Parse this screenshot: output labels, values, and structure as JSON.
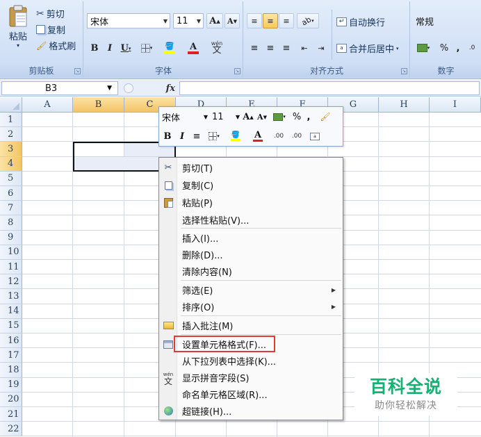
{
  "ribbon": {
    "clipboard": {
      "paste_label": "粘贴",
      "cut_label": "剪切",
      "copy_label": "复制",
      "format_painter_label": "格式刷",
      "group_label": "剪贴板"
    },
    "font": {
      "font_name": "宋体",
      "font_size": "11",
      "grow_label": "A",
      "shrink_label": "A",
      "bold": "B",
      "italic": "I",
      "underline": "U",
      "font_color_glyph": "A",
      "phonetic_glyph": "wén",
      "group_label": "字体"
    },
    "alignment": {
      "wrap_text_label": "自动换行",
      "merge_center_label": "合并后居中",
      "group_label": "对齐方式"
    },
    "number": {
      "format_value": "常规",
      "percent": "%",
      "comma": ",",
      "group_label": "数字"
    }
  },
  "formula_bar": {
    "name_box": "B3",
    "fx_label": "fx",
    "formula": ""
  },
  "columns": [
    "A",
    "B",
    "C",
    "D",
    "E",
    "F",
    "G",
    "H",
    "I"
  ],
  "rows": [
    "1",
    "2",
    "3",
    "4",
    "5",
    "6",
    "7",
    "8",
    "9",
    "10",
    "11",
    "12",
    "13",
    "14",
    "15",
    "16",
    "17",
    "18",
    "19",
    "20",
    "21",
    "22"
  ],
  "mini_toolbar": {
    "font_name": "宋体",
    "font_size": "11",
    "grow": "A",
    "shrink": "A",
    "percent": "%",
    "comma": ",",
    "bold": "B",
    "italic": "I",
    "font_color": "A",
    "inc_decimal": ".00",
    "dec_decimal": ".00"
  },
  "context_menu": {
    "items": [
      {
        "label": "剪切(T)",
        "icon": "scissors-icon"
      },
      {
        "label": "复制(C)",
        "icon": "copy-icon"
      },
      {
        "label": "粘贴(P)",
        "icon": "paste-icon"
      },
      {
        "label": "选择性粘贴(V)...",
        "icon": ""
      },
      {
        "label": "插入(I)...",
        "icon": ""
      },
      {
        "label": "删除(D)...",
        "icon": ""
      },
      {
        "label": "清除内容(N)",
        "icon": ""
      },
      {
        "label": "筛选(E)",
        "icon": "",
        "submenu": true
      },
      {
        "label": "排序(O)",
        "icon": "",
        "submenu": true
      },
      {
        "label": "插入批注(M)",
        "icon": "comment-icon"
      },
      {
        "label": "设置单元格格式(F)...",
        "icon": "format-cells-icon"
      },
      {
        "label": "从下拉列表中选择(K)...",
        "icon": ""
      },
      {
        "label": "显示拼音字段(S)",
        "icon": "phonetic-icon"
      },
      {
        "label": "命名单元格区域(R)...",
        "icon": ""
      },
      {
        "label": "超链接(H)...",
        "icon": "hyperlink-icon"
      }
    ]
  },
  "watermark": {
    "title": "百科全说",
    "subtitle": "助你轻松解决"
  },
  "colors": {
    "selection_header": "#f4c466",
    "highlight_box": "#e53935",
    "watermark_green": "#15b273"
  }
}
